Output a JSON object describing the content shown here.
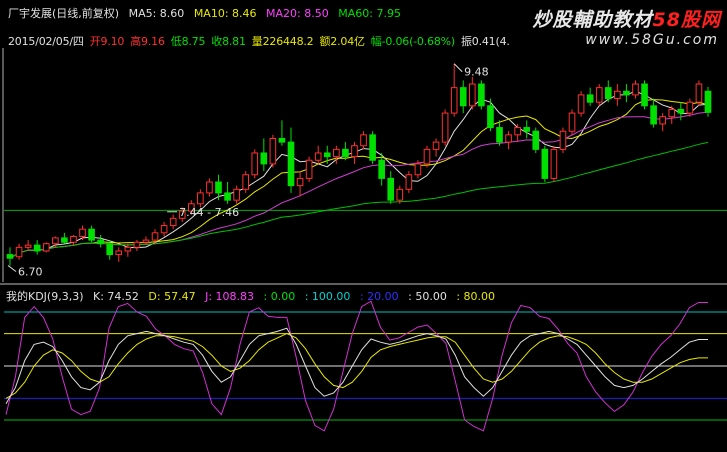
{
  "header": {
    "symbol": "厂宇发展(日线,前复权)",
    "ma5": "MA5: 8.60",
    "ma10": "MA10: 8.46",
    "ma20": "MA20: 8.50",
    "ma60": "MA60: 7.95"
  },
  "watermark": {
    "prefix": "炒股輔助教材",
    "brand": "58股网",
    "url": "www.58Gu.com"
  },
  "quote": {
    "date": "2015/02/05/四",
    "open_label": "开",
    "open": "9.10",
    "high_label": "高",
    "high": "9.16",
    "low_label": "低",
    "low": "8.75",
    "close_label": "收",
    "close": "8.81",
    "vol_label": "量",
    "vol": "226448.2",
    "amount_label": "额",
    "amount": "2.04亿",
    "chg_label": "幅",
    "chg": "-0.06(-0.68%)",
    "amp_label": "振",
    "amp": "0.41(4."
  },
  "annotations": {
    "high_mark": "9.48",
    "mid_mark": "7.44 - 7.46",
    "low_mark": "6.70"
  },
  "kdj": {
    "name": "我的KDJ(9,3,3)",
    "k": "K: 74.52",
    "d": "D: 57.47",
    "j": "J: 108.83",
    "l0": ": 0.00",
    "l100": ": 100.00",
    "l20": ": 20.00",
    "l50": ": 50.00",
    "l80": ": 80.00"
  },
  "colors": {
    "up": "#ff3030",
    "down": "#00e000",
    "ma5": "#e0e0e0",
    "ma10": "#e8e800",
    "ma20": "#d040d0",
    "ma60": "#00c000",
    "k": "#e0e0e0",
    "d": "#e8e800",
    "j": "#d030d0"
  },
  "chart_data": {
    "type": "candlestick",
    "price_range": [
      6.5,
      9.6
    ],
    "candles": [
      [
        6.85,
        6.95,
        6.7,
        6.8
      ],
      [
        6.82,
        7.0,
        6.78,
        6.95
      ],
      [
        6.95,
        7.05,
        6.9,
        6.98
      ],
      [
        6.98,
        7.05,
        6.85,
        6.9
      ],
      [
        6.9,
        7.02,
        6.88,
        7.0
      ],
      [
        7.0,
        7.1,
        6.95,
        7.08
      ],
      [
        7.08,
        7.15,
        7.0,
        7.02
      ],
      [
        7.02,
        7.12,
        6.98,
        7.1
      ],
      [
        7.1,
        7.25,
        7.05,
        7.2
      ],
      [
        7.2,
        7.25,
        7.02,
        7.05
      ],
      [
        7.05,
        7.12,
        6.95,
        7.0
      ],
      [
        7.0,
        7.05,
        6.78,
        6.85
      ],
      [
        6.85,
        6.95,
        6.75,
        6.9
      ],
      [
        6.9,
        7.0,
        6.82,
        6.95
      ],
      [
        6.95,
        7.05,
        6.9,
        7.02
      ],
      [
        7.02,
        7.1,
        6.98,
        7.05
      ],
      [
        7.05,
        7.2,
        7.0,
        7.15
      ],
      [
        7.15,
        7.3,
        7.1,
        7.25
      ],
      [
        7.25,
        7.4,
        7.2,
        7.35
      ],
      [
        7.35,
        7.5,
        7.3,
        7.45
      ],
      [
        7.45,
        7.6,
        7.4,
        7.55
      ],
      [
        7.55,
        7.75,
        7.5,
        7.7
      ],
      [
        7.7,
        7.9,
        7.65,
        7.85
      ],
      [
        7.85,
        7.95,
        7.6,
        7.7
      ],
      [
        7.7,
        7.85,
        7.55,
        7.6
      ],
      [
        7.6,
        7.8,
        7.55,
        7.75
      ],
      [
        7.75,
        8.0,
        7.7,
        7.95
      ],
      [
        7.95,
        8.3,
        7.9,
        8.25
      ],
      [
        8.25,
        8.45,
        8.0,
        8.1
      ],
      [
        8.1,
        8.5,
        8.05,
        8.45
      ],
      [
        8.45,
        8.7,
        8.35,
        8.4
      ],
      [
        8.4,
        8.6,
        7.7,
        7.8
      ],
      [
        7.8,
        8.0,
        7.65,
        7.9
      ],
      [
        7.9,
        8.2,
        7.85,
        8.15
      ],
      [
        8.15,
        8.35,
        8.1,
        8.25
      ],
      [
        8.25,
        8.35,
        8.1,
        8.2
      ],
      [
        8.2,
        8.35,
        8.1,
        8.3
      ],
      [
        8.3,
        8.4,
        8.15,
        8.2
      ],
      [
        8.2,
        8.4,
        8.1,
        8.35
      ],
      [
        8.35,
        8.55,
        8.3,
        8.5
      ],
      [
        8.5,
        8.55,
        8.1,
        8.15
      ],
      [
        8.15,
        8.25,
        7.8,
        7.9
      ],
      [
        7.9,
        8.0,
        7.55,
        7.6
      ],
      [
        7.6,
        7.8,
        7.55,
        7.75
      ],
      [
        7.75,
        8.0,
        7.7,
        7.95
      ],
      [
        7.95,
        8.15,
        7.9,
        8.1
      ],
      [
        8.1,
        8.35,
        8.05,
        8.3
      ],
      [
        8.3,
        8.45,
        8.2,
        8.4
      ],
      [
        8.4,
        8.85,
        8.35,
        8.8
      ],
      [
        8.8,
        9.48,
        8.75,
        9.15
      ],
      [
        9.15,
        9.25,
        8.8,
        8.9
      ],
      [
        8.9,
        9.3,
        8.85,
        9.2
      ],
      [
        9.2,
        9.25,
        8.85,
        8.9
      ],
      [
        8.9,
        9.0,
        8.55,
        8.6
      ],
      [
        8.6,
        8.7,
        8.35,
        8.4
      ],
      [
        8.4,
        8.55,
        8.3,
        8.5
      ],
      [
        8.5,
        8.65,
        8.4,
        8.6
      ],
      [
        8.6,
        8.7,
        8.45,
        8.55
      ],
      [
        8.55,
        8.6,
        8.25,
        8.3
      ],
      [
        8.3,
        8.35,
        7.85,
        7.9
      ],
      [
        7.9,
        8.35,
        7.85,
        8.3
      ],
      [
        8.3,
        8.6,
        8.25,
        8.55
      ],
      [
        8.55,
        8.85,
        8.5,
        8.8
      ],
      [
        8.8,
        9.1,
        8.75,
        9.05
      ],
      [
        9.05,
        9.15,
        8.9,
        8.95
      ],
      [
        8.95,
        9.2,
        8.9,
        9.15
      ],
      [
        9.15,
        9.25,
        8.95,
        9.0
      ],
      [
        9.0,
        9.2,
        8.9,
        9.1
      ],
      [
        9.1,
        9.2,
        8.95,
        9.05
      ],
      [
        9.05,
        9.25,
        9.0,
        9.2
      ],
      [
        9.2,
        9.25,
        8.85,
        8.9
      ],
      [
        8.9,
        9.0,
        8.6,
        8.65
      ],
      [
        8.65,
        8.8,
        8.55,
        8.75
      ],
      [
        8.75,
        8.9,
        8.65,
        8.85
      ],
      [
        8.85,
        8.95,
        8.7,
        8.8
      ],
      [
        8.8,
        9.0,
        8.75,
        8.95
      ],
      [
        8.95,
        9.25,
        8.9,
        9.2
      ],
      [
        9.1,
        9.16,
        8.75,
        8.81
      ]
    ],
    "kdj_range": [
      0,
      100
    ],
    "k": [
      15,
      30,
      55,
      70,
      72,
      68,
      55,
      40,
      30,
      28,
      35,
      55,
      70,
      78,
      80,
      82,
      80,
      78,
      75,
      72,
      70,
      60,
      45,
      35,
      40,
      55,
      70,
      78,
      80,
      82,
      85,
      70,
      50,
      30,
      22,
      25,
      35,
      50,
      65,
      75,
      72,
      70,
      72,
      75,
      78,
      80,
      78,
      75,
      60,
      40,
      30,
      22,
      30,
      45,
      60,
      72,
      78,
      80,
      82,
      80,
      75,
      70,
      60,
      50,
      40,
      32,
      30,
      32,
      38,
      45,
      52,
      58,
      65,
      72,
      74.5,
      74.5
    ],
    "d": [
      20,
      25,
      35,
      50,
      60,
      65,
      62,
      55,
      45,
      38,
      35,
      40,
      52,
      62,
      70,
      75,
      78,
      78,
      77,
      75,
      73,
      68,
      60,
      50,
      45,
      48,
      55,
      65,
      72,
      76,
      80,
      76,
      66,
      52,
      40,
      32,
      30,
      35,
      45,
      58,
      65,
      68,
      70,
      72,
      74,
      76,
      77,
      77,
      72,
      60,
      48,
      38,
      35,
      38,
      45,
      55,
      65,
      72,
      76,
      78,
      77,
      74,
      70,
      62,
      52,
      44,
      38,
      35,
      35,
      38,
      43,
      48,
      53,
      56,
      57.5,
      57.5
    ],
    "j": [
      5,
      40,
      95,
      105,
      95,
      75,
      40,
      10,
      5,
      8,
      30,
      85,
      105,
      108,
      100,
      96,
      84,
      78,
      70,
      66,
      64,
      44,
      15,
      5,
      30,
      70,
      100,
      104,
      96,
      95,
      95,
      58,
      18,
      -5,
      -10,
      10,
      45,
      80,
      105,
      110,
      86,
      74,
      76,
      81,
      86,
      88,
      80,
      71,
      36,
      0,
      -6,
      -10,
      20,
      60,
      90,
      106,
      104,
      96,
      94,
      84,
      71,
      62,
      40,
      26,
      16,
      8,
      14,
      26,
      44,
      59,
      70,
      78,
      89,
      104,
      108.8,
      108.8
    ],
    "kdj_levels": [
      0,
      20,
      50,
      80,
      100
    ]
  }
}
